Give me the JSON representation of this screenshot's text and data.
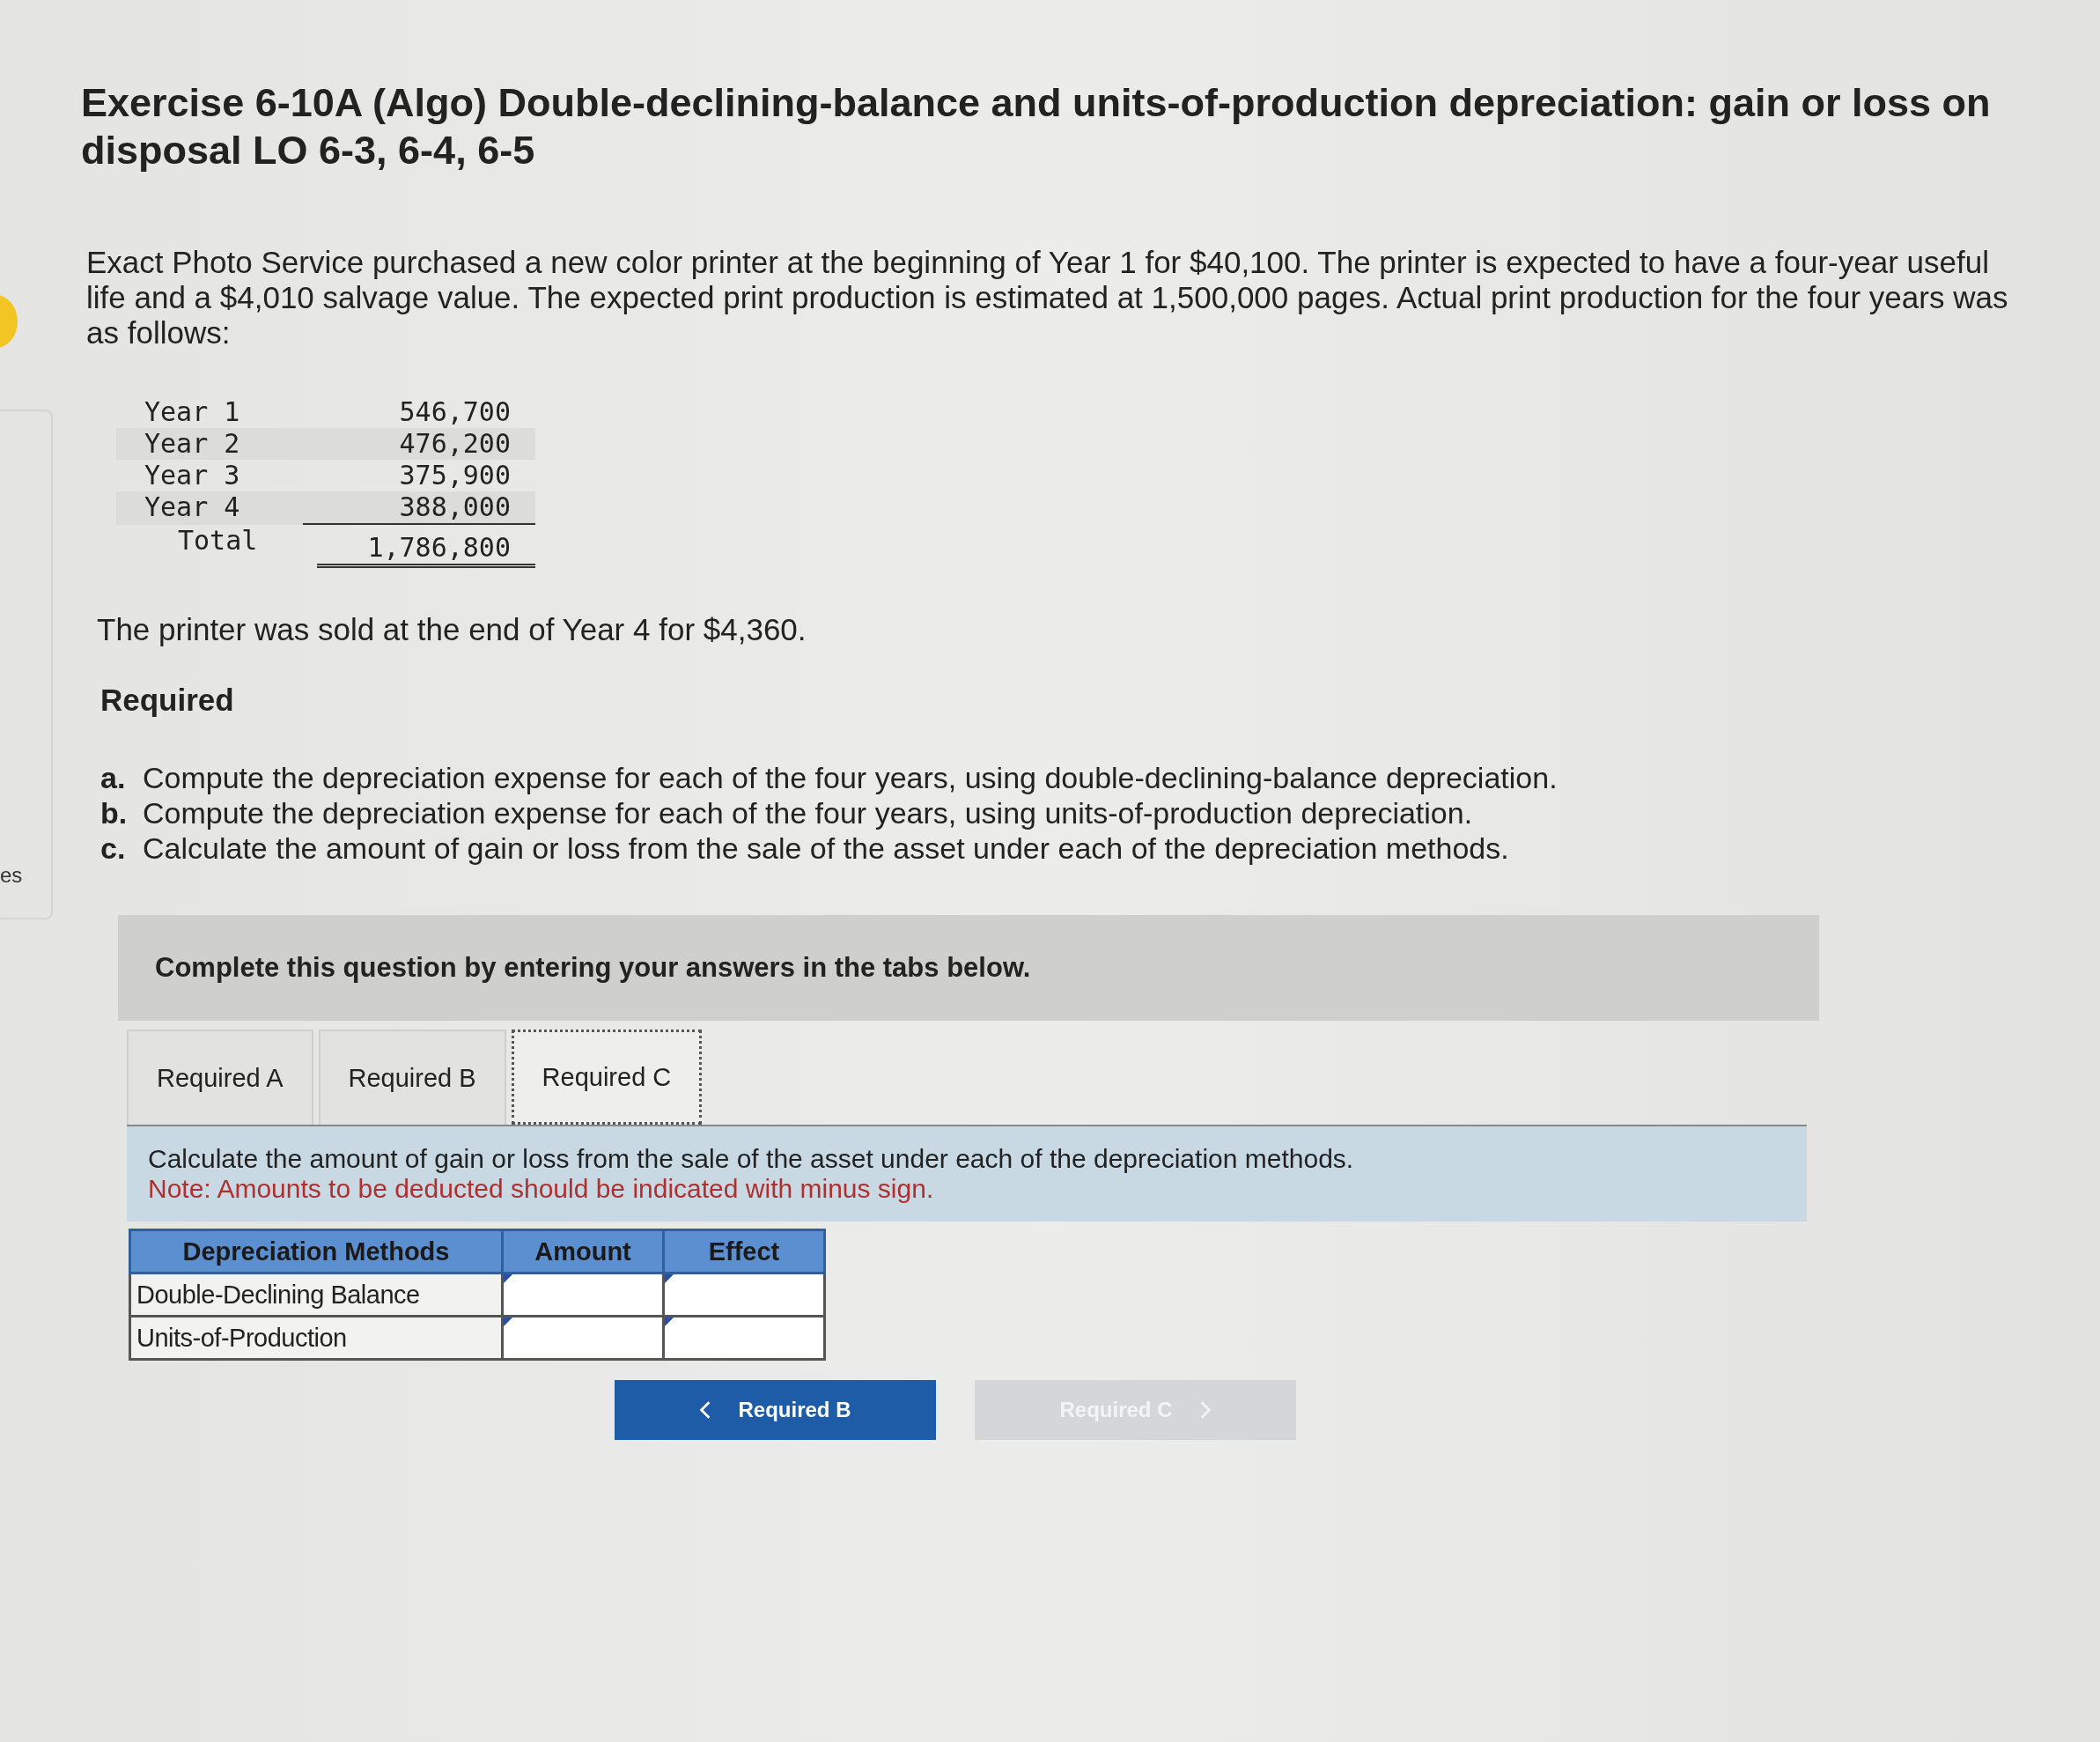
{
  "side_tab": {
    "label": "es"
  },
  "title": "Exercise 6-10A (Algo) Double-declining-balance and units-of-production depreciation: gain or loss on disposal LO 6-3, 6-4, 6-5",
  "intro": "Exact Photo Service purchased a new color printer at the beginning of Year 1 for $40,100. The printer is expected to have a four-year useful life and a $4,010 salvage value. The expected print production is estimated at 1,500,000 pages. Actual print production for the four years was as follows:",
  "production": {
    "rows": [
      {
        "year": "Year 1",
        "pages": "546,700"
      },
      {
        "year": "Year 2",
        "pages": "476,200"
      },
      {
        "year": "Year 3",
        "pages": "375,900"
      },
      {
        "year": "Year 4",
        "pages": "388,000"
      }
    ],
    "total_label": "Total",
    "total": "1,786,800"
  },
  "sale": "The printer was sold at the end of Year 4 for $4,360.",
  "required_heading": "Required",
  "requirements": [
    {
      "letter": "a.",
      "text": "Compute the depreciation expense for each of the four years, using double-declining-balance depreciation."
    },
    {
      "letter": "b.",
      "text": "Compute the depreciation expense for each of the four years, using units-of-production depreciation."
    },
    {
      "letter": "c.",
      "text": "Calculate the amount of gain or loss from the sale of the asset under each of the depreciation methods."
    }
  ],
  "banner": "Complete this question by entering your answers in the tabs below.",
  "tabs": [
    {
      "label": "Required A",
      "selected": false
    },
    {
      "label": "Required B",
      "selected": false
    },
    {
      "label": "Required C",
      "selected": true
    }
  ],
  "question": "Calculate the amount of gain or loss from the sale of the asset under each of the depreciation methods.",
  "note": "Note: Amounts to be deducted should be indicated with minus sign.",
  "answer_table": {
    "columns": [
      "Depreciation Methods",
      "Amount",
      "Effect"
    ],
    "rows": [
      {
        "method": "Double-Declining Balance"
      },
      {
        "method": "Units-of-Production"
      }
    ]
  },
  "nav": [
    {
      "kind": "prev",
      "label": "Required B",
      "disabled": false
    },
    {
      "kind": "next",
      "label": "Required C",
      "disabled": true
    }
  ]
}
